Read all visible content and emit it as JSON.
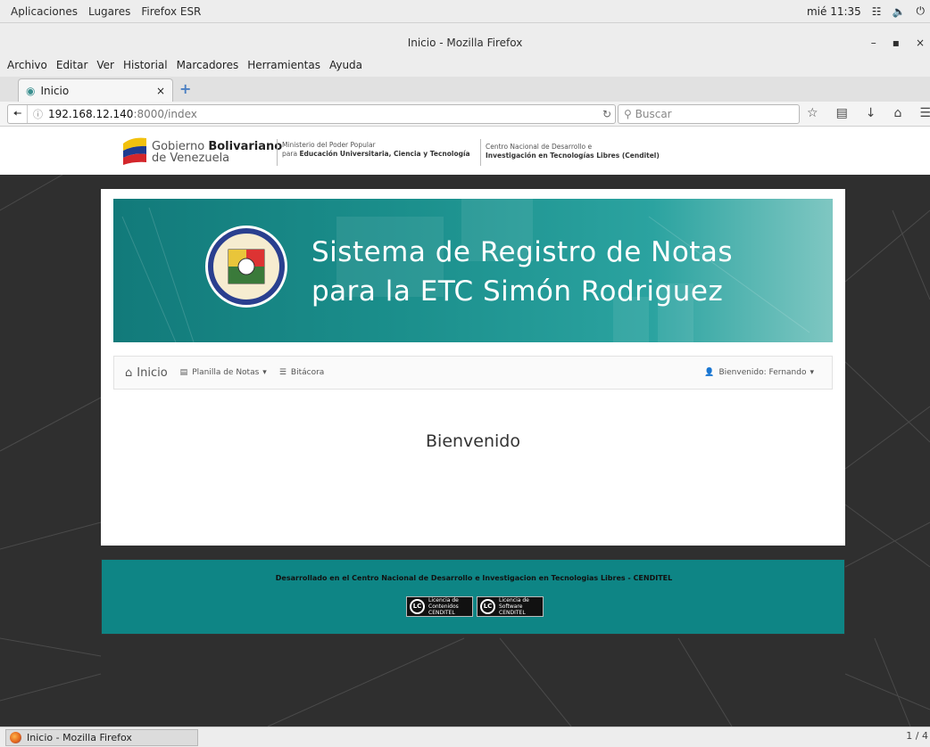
{
  "system_bar": {
    "apps": "Aplicaciones",
    "places": "Lugares",
    "app_name": "Firefox ESR",
    "clock": "mié 11:35"
  },
  "window": {
    "title": "Inicio - Mozilla Firefox"
  },
  "menu": [
    "Archivo",
    "Editar",
    "Ver",
    "Historial",
    "Marcadores",
    "Herramientas",
    "Ayuda"
  ],
  "tab": {
    "label": "Inicio"
  },
  "address": {
    "host": "192.168.12.140",
    "rest": ":8000/index",
    "search_placeholder": "Buscar"
  },
  "gov_header": {
    "gov_line1": "Gobierno",
    "gov_line1_bold": "Bolivariano",
    "gov_line2": "de Venezuela",
    "ministry_line1": "Ministerio del Poder Popular",
    "ministry_line2_prefix": "para",
    "ministry_line2_bold": "Educación Universitaria, Ciencia y Tecnología",
    "center_line1": "Centro Nacional de Desarrollo e",
    "center_line2": "Investigación en Tecnologías Libres (Cenditel)"
  },
  "banner": {
    "line1": "Sistema de Registro de Notas",
    "line2": "para la ETC Simón Rodriguez"
  },
  "nav": {
    "home": "Inicio",
    "grades": "Planilla de Notas",
    "log": "Bitácora",
    "user": "Bienvenido: Fernando"
  },
  "main": {
    "welcome": "Bienvenido"
  },
  "footer": {
    "text": "Desarrollado en el Centro Nacional de Desarrollo e Investigacion en Tecnologias Libres - CENDITEL",
    "badge1": [
      "Licencia de",
      "Contenidos",
      "CENDITEL"
    ],
    "badge2": [
      "Licencia de",
      "Software",
      "CENDITEL"
    ]
  },
  "taskbar": {
    "task_label": "Inicio - Mozilla Firefox",
    "pager": "1 / 4"
  },
  "colors": {
    "banner_teal": "#1b8f8c",
    "footer_teal": "#0e8585",
    "page_bg": "#2f2f2f"
  }
}
